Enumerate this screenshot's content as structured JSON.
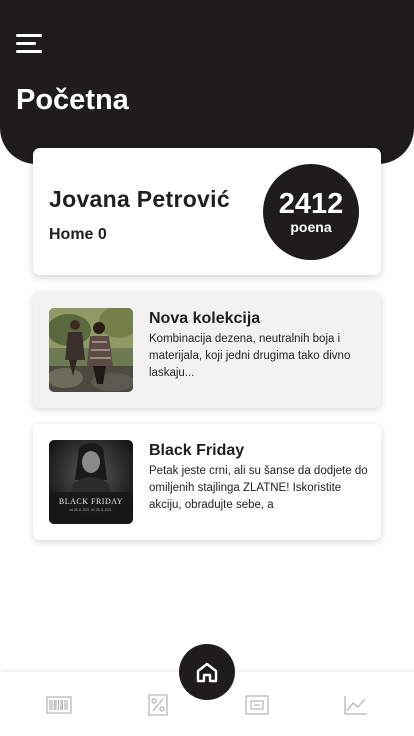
{
  "header": {
    "title": "Početna",
    "menu_icon": "menu-icon"
  },
  "profile": {
    "name": "Jovana Petrović",
    "subtitle": "Home 0",
    "points_value": "2412",
    "points_unit": "poena"
  },
  "news": [
    {
      "title": "Nova kolekcija",
      "description": "Kombinacija dezena, neutralnih boja i materijala, koji jedni drugima tako divno laskaju...",
      "image": "collection-photo"
    },
    {
      "title": "Black Friday",
      "description": "Petak jeste crni, ali su šanse da dodjete do omiljenih stajlinga ZLATNE! Iskoristite akciju, obradujte sebe, a",
      "image": "black-friday-photo",
      "image_caption": "BLACK FRIDAY",
      "image_subcaption": "od 26.11.2021. do 28.11.2021."
    }
  ],
  "bottom_nav": {
    "items": [
      "barcode-icon",
      "discount-icon",
      "receipt-icon",
      "stats-icon"
    ],
    "home": "home-icon"
  },
  "colors": {
    "dark": "#1e1c1c",
    "card_bg": "#f2f2f2",
    "nav_icon": "#b5b5b5"
  }
}
